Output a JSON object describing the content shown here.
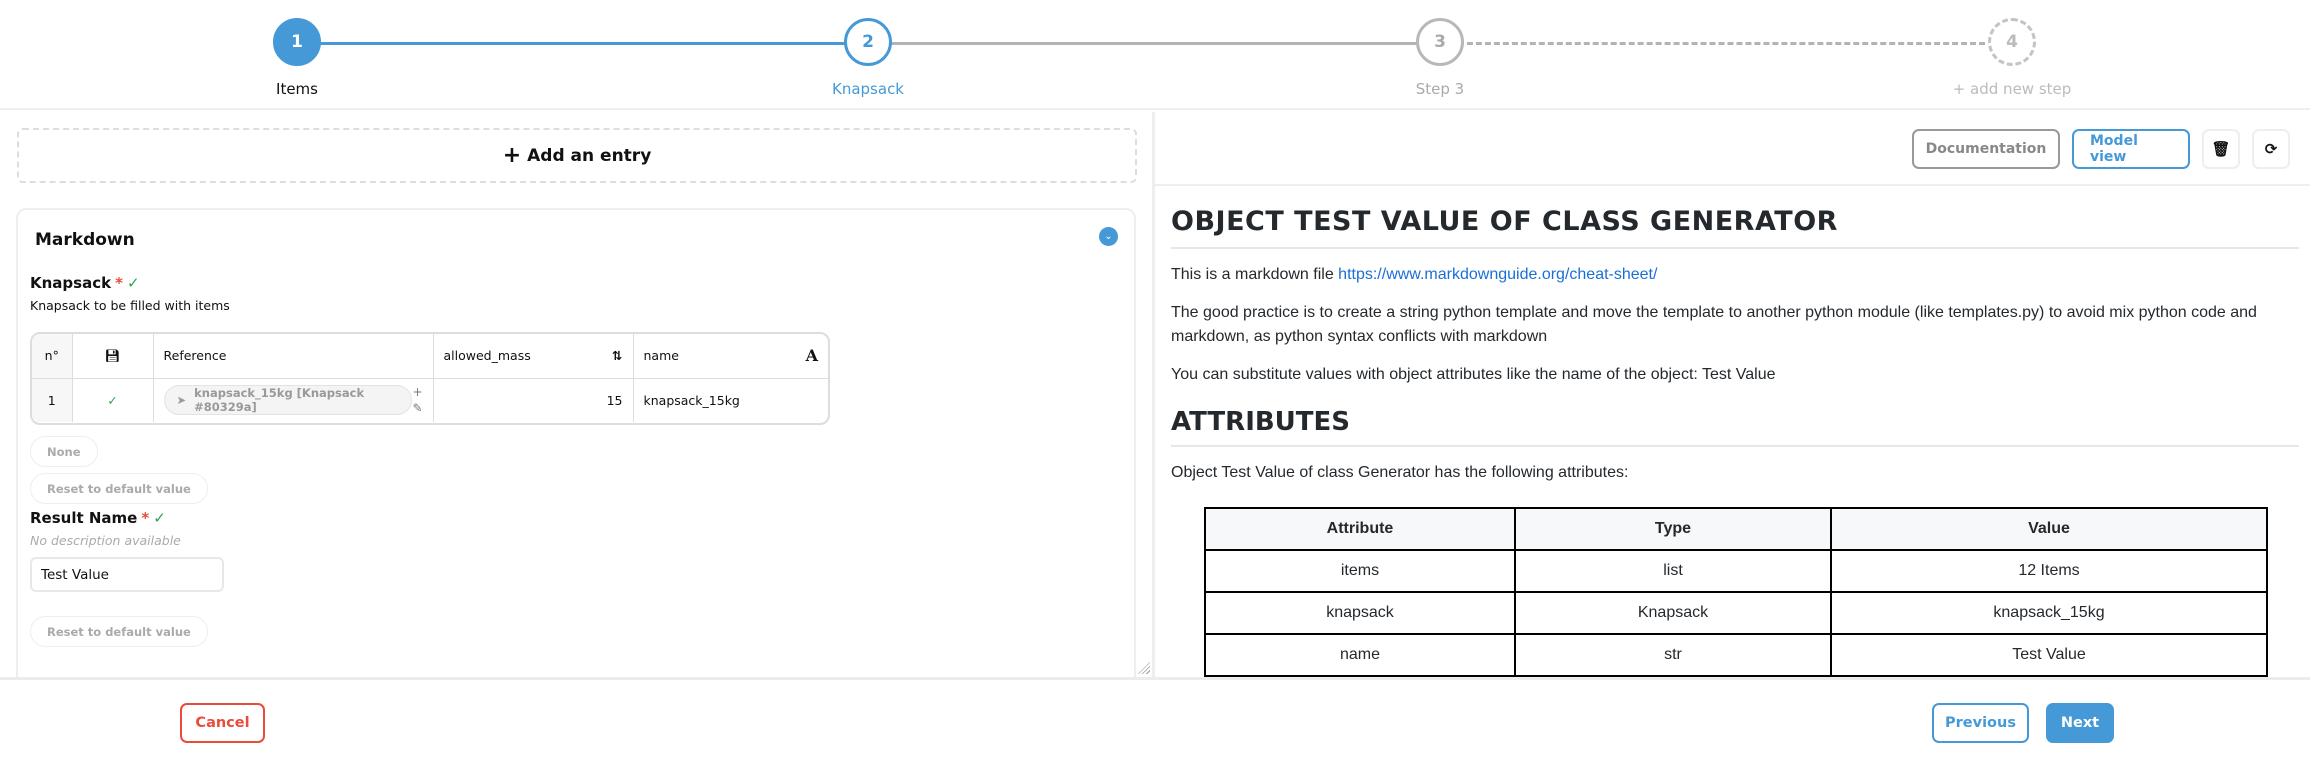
{
  "stepper": {
    "steps": [
      {
        "number": "1",
        "label": "Items",
        "state": "completed"
      },
      {
        "number": "2",
        "label": "Knapsack",
        "state": "active"
      },
      {
        "number": "3",
        "label": "Step 3",
        "state": "pending"
      },
      {
        "number": "4",
        "label": "+ add new step",
        "state": "add"
      }
    ]
  },
  "left": {
    "add_entry_label": "Add an entry",
    "card_title": "Markdown",
    "knapsack": {
      "label": "Knapsack",
      "required_mark": "*",
      "description": "Knapsack to be filled with items",
      "table": {
        "headers": {
          "index": "n°",
          "reference": "Reference",
          "allowed_mass": "allowed_mass",
          "name": "name"
        },
        "rows": [
          {
            "index": "1",
            "reference": "knapsack_15kg [Knapsack #80329a]",
            "allowed_mass": "15",
            "name": "knapsack_15kg"
          }
        ]
      },
      "none_button": "None",
      "reset_button": "Reset to default value"
    },
    "result_name": {
      "label": "Result Name",
      "required_mark": "*",
      "description": "No description available",
      "value": "Test Value",
      "reset_button": "Reset to default value"
    }
  },
  "right": {
    "toolbar": {
      "documentation": "Documentation",
      "model_view": "Model view"
    },
    "markdown": {
      "title": "OBJECT TEST VALUE OF CLASS GENERATOR",
      "intro_text": "This is a markdown file ",
      "intro_link": "https://www.markdownguide.org/cheat-sheet/",
      "paragraph_2": "The good practice is to create a string python template and move the template to another python module (like templates.py) to avoid mix python code and markdown, as python syntax conflicts with markdown",
      "paragraph_3": "You can substitute values with object attributes like the name of the object: Test Value",
      "attributes_heading": "ATTRIBUTES",
      "attributes_intro": "Object Test Value of class Generator has the following attributes:",
      "attributes_table": {
        "headers": [
          "Attribute",
          "Type",
          "Value"
        ],
        "rows": [
          [
            "items",
            "list",
            "12 Items"
          ],
          [
            "knapsack",
            "Knapsack",
            "knapsack_15kg"
          ],
          [
            "name",
            "str",
            "Test Value"
          ]
        ]
      }
    }
  },
  "footer": {
    "cancel": "Cancel",
    "previous": "Previous",
    "next": "Next"
  }
}
